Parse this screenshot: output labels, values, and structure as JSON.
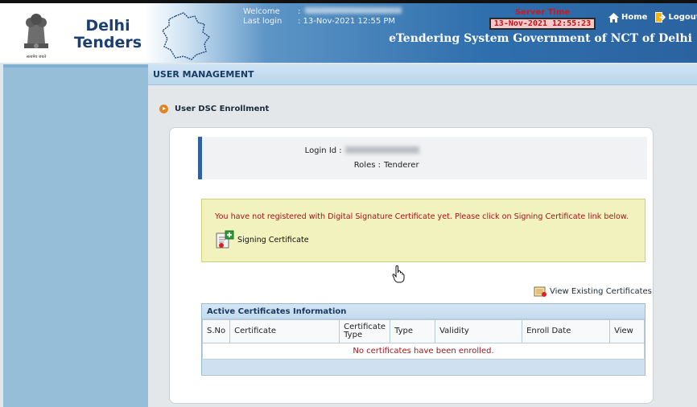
{
  "header": {
    "brand_line1": "Delhi",
    "brand_line2": "Tenders",
    "welcome_label": "Welcome",
    "welcome_sep": ":",
    "last_login_label": "Last login",
    "last_login_value": ":  13-Nov-2021 12:55 PM",
    "server_time_label": "Server Time",
    "server_time_value": "13-Nov-2021 12:55:23",
    "home_label": "Home",
    "logout_label": "Logout",
    "system_title": "eTendering System Government of NCT of Delhi",
    "emblem_caption": "सत्यमेव जयते"
  },
  "titlebar": {
    "title": "USER MANAGEMENT"
  },
  "section": {
    "title": "User DSC Enrollment"
  },
  "login_info": {
    "login_id_label": "Login Id :",
    "login_id_value": "alok.autotest@gmail.com",
    "roles_label": "Roles :",
    "roles_value": "Tenderer"
  },
  "notice": {
    "message": "You have not registered with Digital Signature Certificate yet. Please click on Signing Certificate link below.",
    "signing_link": "Signing Certificate"
  },
  "view_existing": "View Existing Certificates",
  "cert_table": {
    "caption": "Active Certificates Information",
    "columns": [
      "S.No",
      "Certificate",
      "Certificate Type",
      "Type",
      "Validity",
      "Enroll Date",
      "View"
    ],
    "empty_message": "No certificates have been enrolled."
  },
  "colors": {
    "header_blue": "#2f6fad",
    "left_nav": "#96bed8",
    "notice_bg": "#f2f2bf",
    "notice_text": "#a2161a",
    "server_time_text": "#c01010"
  }
}
